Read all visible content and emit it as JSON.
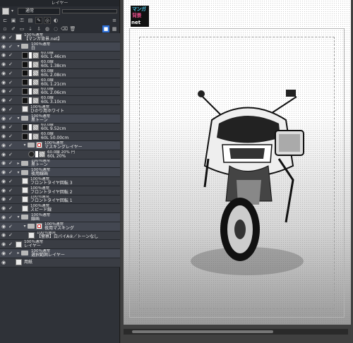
{
  "panel": {
    "title": "レイヤー",
    "blend_mode": "通常",
    "icons": [
      "new-raster-icon",
      "new-vector-icon",
      "new-folder-icon",
      "transfer-icon",
      "clip-icon",
      "lock-icon",
      "lock-alpha-icon",
      "reference-icon",
      "draft-icon",
      "color-icon",
      "mask-icon",
      "ruler-icon",
      "layer-color-icon"
    ]
  },
  "layers": [
    {
      "kind": "layer",
      "indent": 0,
      "line1": "100％通常",
      "line2": "【マンガ背景.net】",
      "thumb": "plain"
    },
    {
      "kind": "folder",
      "indent": 0,
      "selected": true,
      "open": true,
      "line1": "100％通常",
      "line2": "白"
    },
    {
      "kind": "tone",
      "indent": 1,
      "line1": "60.0線",
      "line2": "60L 1.46cm"
    },
    {
      "kind": "tone",
      "indent": 1,
      "line1": "60.0線",
      "line2": "60L 1.38cm"
    },
    {
      "kind": "tone",
      "indent": 1,
      "line1": "60.0線",
      "line2": "60L 2.08cm"
    },
    {
      "kind": "tone",
      "indent": 1,
      "line1": "60.0線",
      "line2": "60L 1.21cm"
    },
    {
      "kind": "tone",
      "indent": 1,
      "line1": "60.0線",
      "line2": "60L 2.06cm"
    },
    {
      "kind": "tone",
      "indent": 1,
      "line1": "60.0線",
      "line2": "60L 3.10cm"
    },
    {
      "kind": "layer",
      "indent": 1,
      "line1": "100％通常",
      "line2": "ひかり用ホワイト",
      "thumb": "plain"
    },
    {
      "kind": "folder",
      "indent": 0,
      "open": true,
      "line1": "100％通常",
      "line2": "黒トーン"
    },
    {
      "kind": "tone",
      "indent": 1,
      "line1": "60.0線",
      "line2": "60L 9.52cm"
    },
    {
      "kind": "tone",
      "indent": 1,
      "line1": "60.0線",
      "line2": "60L 50.00cm"
    },
    {
      "kind": "folder",
      "indent": 1,
      "open": true,
      "mask": true,
      "line1": "100％通常",
      "line2": "マスキングレイヤー"
    },
    {
      "kind": "tone",
      "indent": 2,
      "circle": true,
      "line1": "60.0線 20% 円",
      "line2": "60L 20%"
    },
    {
      "kind": "folder",
      "indent": 0,
      "open": false,
      "line1": "100％通常",
      "line2": "黒トーン"
    },
    {
      "kind": "folder",
      "indent": 0,
      "open": true,
      "line1": "100％通常",
      "line2": "夜用線画"
    },
    {
      "kind": "layer",
      "indent": 1,
      "line1": "100％通常",
      "line2": "フロントタイヤ回転 3",
      "thumb": "plain"
    },
    {
      "kind": "layer",
      "indent": 1,
      "line1": "100％通常",
      "line2": "フロントタイヤ回転 2",
      "thumb": "plain"
    },
    {
      "kind": "layer",
      "indent": 1,
      "line1": "100％通常",
      "line2": "フロントタイヤ回転 1",
      "thumb": "plain"
    },
    {
      "kind": "layer",
      "indent": 1,
      "line1": "100％通常",
      "line2": "スピード線",
      "thumb": "plain"
    },
    {
      "kind": "folder",
      "indent": 0,
      "open": true,
      "line1": "100％通常",
      "line2": "線画"
    },
    {
      "kind": "folder",
      "indent": 1,
      "open": true,
      "mask": true,
      "line1": "100％通常",
      "line2": "夜用マスキング"
    },
    {
      "kind": "layer",
      "indent": 2,
      "line1": "100％通常",
      "line2": "【警察】白バイA④／トーンなし",
      "thumb": "plain"
    },
    {
      "kind": "layer",
      "indent": 0,
      "line1": "100％通常",
      "line2": "レイヤー",
      "thumb": "plain"
    },
    {
      "kind": "folder",
      "indent": 0,
      "open": false,
      "line1": "100％通常",
      "line2": "選択範囲レイヤー"
    },
    {
      "kind": "paper",
      "indent": 0,
      "line1": "",
      "line2": "用紙"
    }
  ],
  "logo": {
    "line1": "マンガ",
    "line2": "背景",
    "line3": "net"
  },
  "colors": {
    "panel_bg": "#2f3238",
    "selected_row": "#5a6d8c",
    "canvas_bg": "#404040",
    "accent": "#2d6fd6"
  }
}
